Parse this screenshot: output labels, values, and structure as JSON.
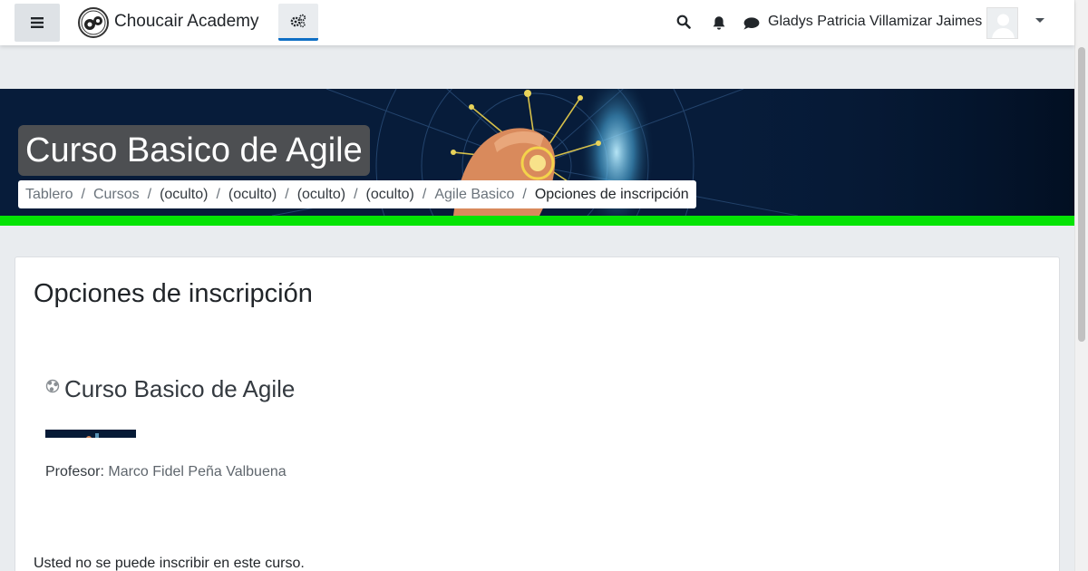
{
  "navbar": {
    "brand_name": "Choucair Academy",
    "user_name": "Gladys Patricia Villamizar Jaimes",
    "icons": {
      "drawer": "hamburger-menu-icon",
      "admin": "gears-icon",
      "search": "search-icon",
      "notifications": "bell-icon",
      "messages": "chat-bubble-icon",
      "user_menu": "caret-down-icon"
    }
  },
  "header": {
    "course_title": "Curso Basico de Agile",
    "breadcrumb": [
      {
        "label": "Tablero",
        "style": "link"
      },
      {
        "label": "Cursos",
        "style": "link"
      },
      {
        "label": "(oculto)",
        "style": "plain"
      },
      {
        "label": "(oculto)",
        "style": "plain"
      },
      {
        "label": "(oculto)",
        "style": "plain"
      },
      {
        "label": "(oculto)",
        "style": "plain"
      },
      {
        "label": "Agile Basico",
        "style": "link"
      },
      {
        "label": "Opciones de inscripción",
        "style": "current"
      }
    ],
    "separator": "/"
  },
  "main": {
    "heading": "Opciones de inscripción",
    "coursebox": {
      "course_name": "Curso Basico de Agile",
      "teacher_role": "Profesor:",
      "teacher_name": "Marco Fidel Peña Valbuena"
    },
    "enrol_message": "Usted no se puede inscribir en este curso."
  },
  "colors": {
    "accent_bar": "#05e305",
    "banner_bg": "#061a36",
    "active_tab_underline": "#0f6fc5"
  }
}
